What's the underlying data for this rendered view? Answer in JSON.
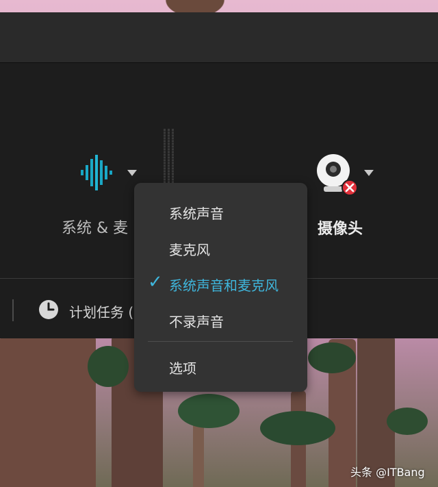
{
  "sources": {
    "audio_label": "系统 & 麦",
    "camera_label": "摄像头"
  },
  "schedule": {
    "label": "计划任务 ("
  },
  "audio_menu": {
    "items": [
      {
        "label": "系统声音",
        "selected": false
      },
      {
        "label": "麦克风",
        "selected": false
      },
      {
        "label": "系统声音和麦克风",
        "selected": true
      },
      {
        "label": "不录声音",
        "selected": false
      }
    ],
    "options_label": "选项",
    "check_mark": "✓"
  },
  "icons": {
    "audio": "audio-waveform-icon",
    "camera": "webcam-disabled-icon",
    "clock": "clock-icon",
    "caret": "caret-down-icon"
  },
  "colors": {
    "accent": "#3fb6dc",
    "panel": "#1d1d1d",
    "menu": "#333333",
    "error": "#e0303a"
  },
  "watermark": "头条 @ITBang"
}
